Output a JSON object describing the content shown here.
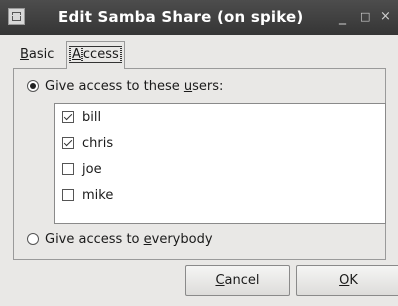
{
  "window": {
    "title": "Edit Samba Share (on spike)",
    "controls": {
      "minimize": "_",
      "maximize": "□",
      "close": "×"
    }
  },
  "tabs": {
    "basic": {
      "first": "B",
      "rest": "asic"
    },
    "access": {
      "first": "A",
      "rest": "ccess",
      "active": true
    }
  },
  "access": {
    "users_option": {
      "pre": "Give access to these ",
      "accel": "u",
      "post": "sers:",
      "selected": true
    },
    "users": [
      {
        "name": "bill",
        "checked": true
      },
      {
        "name": "chris",
        "checked": true
      },
      {
        "name": "joe",
        "checked": false
      },
      {
        "name": "mike",
        "checked": false
      }
    ],
    "everybody_option": {
      "pre": "Give access to ",
      "accel": "e",
      "post": "verybody",
      "selected": false
    }
  },
  "buttons": {
    "cancel": {
      "accel": "C",
      "rest": "ancel"
    },
    "ok": {
      "accel": "O",
      "rest": "K"
    }
  }
}
